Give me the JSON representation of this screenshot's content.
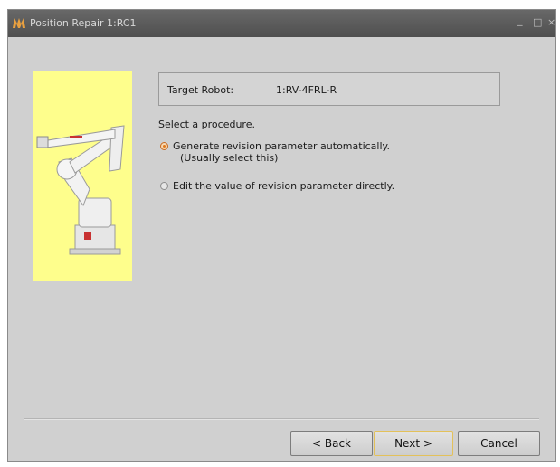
{
  "window": {
    "title": "Position Repair 1:RC1",
    "controls": {
      "minimize": "_",
      "maximize": "□",
      "close": "×"
    }
  },
  "target": {
    "label": "Target Robot:",
    "value": "1:RV-4FRL-R"
  },
  "procedure": {
    "prompt": "Select a procedure.",
    "options": [
      {
        "label": "Generate revision parameter automatically.",
        "sublabel": "(Usually select this)",
        "selected": true
      },
      {
        "label": "Edit the value of revision parameter directly.",
        "selected": false
      }
    ]
  },
  "buttons": {
    "back": "< Back",
    "next": "Next >",
    "cancel": "Cancel"
  },
  "colors": {
    "image_panel": "#fefe8c",
    "radio_accent": "#e07a1e",
    "next_focus_border": "#e3c15a"
  }
}
